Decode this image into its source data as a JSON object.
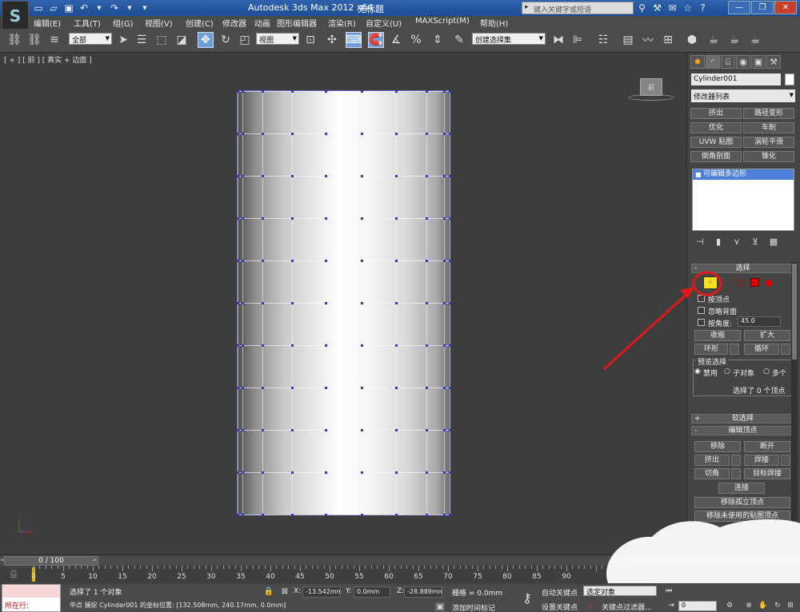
{
  "titlebar": {
    "app_title": "Autodesk 3ds Max  2012 x64",
    "file_name": "无标题",
    "search_placeholder": "键入关键字或短语",
    "window_buttons": [
      "minimize-icon",
      "restore-icon",
      "close-icon"
    ]
  },
  "menubar": {
    "items": [
      "编辑(E)",
      "工具(T)",
      "组(G)",
      "视图(V)",
      "创建(C)",
      "修改器",
      "动画",
      "图形编辑器",
      "渲染(R)",
      "自定义(U)",
      "MAXScript(M)",
      "帮助(H)"
    ]
  },
  "toolbar": {
    "selection_filter": "全部",
    "reference_coord": "视图",
    "named_selection": "创建选择集"
  },
  "viewport": {
    "label": "[ + ] [ 前 ] [ 真实 + 边面 ]",
    "gizmo_label": "前"
  },
  "command_panel": {
    "object_name": "Cylinder001",
    "object_color": "#ffffff",
    "modifier_list": "修改器列表",
    "modifier_buttons": [
      "挤出",
      "路径变形",
      "优化",
      "车削",
      "UVW 贴图",
      "涡轮平滑",
      "倒角剖面",
      "锥化"
    ],
    "stack_item": "可编辑多边形",
    "selection": {
      "header": "选择",
      "by_vertex": "按顶点",
      "ignore_backfacing": "忽略背面",
      "by_angle": "按角度:",
      "angle_value": "45.0",
      "shrink": "收缩",
      "grow": "扩大",
      "ring": "环形",
      "loop": "循环",
      "preview_header": "预览选择",
      "preview_off": "禁用",
      "preview_subobj": "子对象",
      "preview_multi": "多个",
      "status": "选择了 0 个顶点"
    },
    "soft_selection": "软选择",
    "edit_vertices": {
      "header": "编辑顶点",
      "remove": "移除",
      "break": "断开",
      "extrude": "挤出",
      "weld": "焊接",
      "chamfer": "切角",
      "target_weld": "目标焊接",
      "connect": "连接",
      "remove_isolated": "移除孤立顶点",
      "remove_unused_map": "移除未使用的贴图顶点"
    }
  },
  "timeline": {
    "frame_display": "0 / 100",
    "ticks": [
      "0",
      "5",
      "10",
      "15",
      "20",
      "25",
      "30",
      "35",
      "40",
      "45",
      "50",
      "55",
      "60",
      "65",
      "70",
      "75",
      "80",
      "85",
      "90"
    ]
  },
  "statusbar": {
    "maxscript_text": "所在行:",
    "selection_status": "选择了 1 个对象",
    "prompt": "中点 捕捉 Cylinder001 的坐标位置: [132.508mm, 240.17mm, 0.0mm]",
    "x_label": "X:",
    "x_value": "-13.542mm",
    "y_label": "Y:",
    "y_value": "0.0mm",
    "z_label": "Z:",
    "z_value": "-28.889mm",
    "grid": "栅格 = 0.0mm",
    "add_time_tag": "添加时间标记",
    "auto_key": "自动关键点",
    "set_key": "设置关键点",
    "selected_dropdown": "选定对象",
    "key_filters": "关键点过滤器...",
    "current_frame": "0"
  },
  "annotation": {
    "circle_color": "#e01818",
    "arrow_color": "#e01818"
  }
}
